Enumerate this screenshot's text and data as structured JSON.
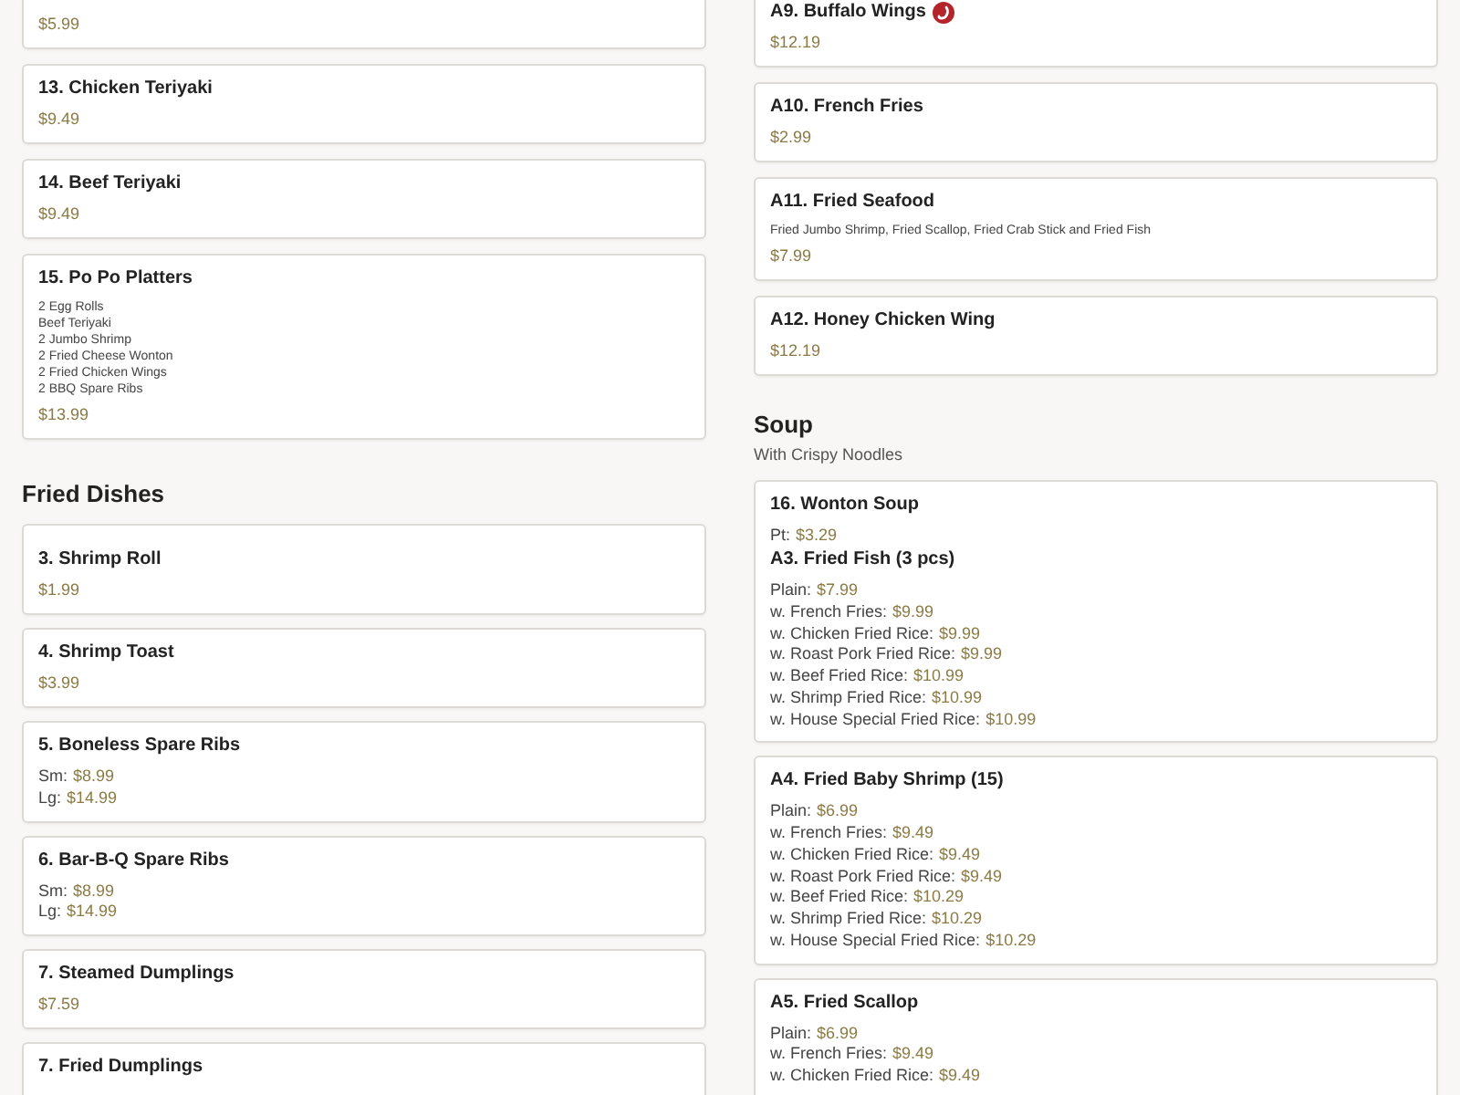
{
  "top_view": {
    "left": [
      {
        "kind": "item",
        "spicy": false,
        "prices": [
          {
            "value": "$5.99"
          }
        ]
      },
      {
        "kind": "item",
        "title": "13. Chicken Teriyaki",
        "spicy": false,
        "prices": [
          {
            "value": "$9.49"
          }
        ]
      },
      {
        "kind": "item",
        "title": "14. Beef Teriyaki",
        "spicy": false,
        "prices": [
          {
            "value": "$9.49"
          }
        ]
      },
      {
        "kind": "item",
        "title": "15. Po Po Platters",
        "spicy": false,
        "description": [
          "2 Egg Rolls",
          "Beef Teriyaki",
          "2 Jumbo Shrimp",
          "2 Fried Cheese Wonton",
          "2 Fried Chicken Wings",
          "2 BBQ Spare Ribs"
        ],
        "prices": [
          {
            "value": "$13.99"
          }
        ]
      },
      {
        "kind": "section",
        "heading": "Fried Dishes"
      },
      {
        "kind": "item",
        "spicy": false
      }
    ],
    "right": [
      {
        "kind": "item",
        "title": "A9. Buffalo Wings",
        "spicy": true,
        "prices": [
          {
            "value": "$12.19"
          }
        ]
      },
      {
        "kind": "item",
        "title": "A10. French Fries",
        "spicy": false,
        "prices": [
          {
            "value": "$2.99"
          }
        ]
      },
      {
        "kind": "item",
        "title": "A11. Fried Seafood",
        "spicy": false,
        "description": [
          "Fried Jumbo Shrimp, Fried Scallop, Fried Crab Stick and Fried Fish"
        ],
        "prices": [
          {
            "value": "$7.99"
          }
        ]
      },
      {
        "kind": "item",
        "title": "A12. Honey Chicken Wing",
        "spicy": false,
        "prices": [
          {
            "value": "$12.19"
          }
        ]
      },
      {
        "kind": "section",
        "heading": "Soup",
        "subheading": "With Crispy Noodles"
      },
      {
        "kind": "item",
        "title": "16. Wonton Soup",
        "spicy": false,
        "prices": [
          {
            "label": "Pt:",
            "value": "$3.29"
          }
        ]
      }
    ]
  },
  "bottom_view": {
    "left": [
      {
        "kind": "item",
        "title": "3. Shrimp Roll",
        "spicy": false,
        "prices": [
          {
            "value": "$1.99"
          }
        ]
      },
      {
        "kind": "item",
        "title": "4. Shrimp Toast",
        "spicy": false,
        "prices": [
          {
            "value": "$3.99"
          }
        ]
      },
      {
        "kind": "item",
        "title": "5. Boneless Spare Ribs",
        "spicy": false,
        "prices": [
          {
            "label": "Sm:",
            "value": "$8.99"
          },
          {
            "label": "Lg:",
            "value": "$14.99"
          }
        ]
      },
      {
        "kind": "item",
        "title": "6. Bar-B-Q Spare Ribs",
        "spicy": false,
        "prices": [
          {
            "label": "Sm:",
            "value": "$8.99"
          },
          {
            "label": "Lg:",
            "value": "$14.99"
          }
        ]
      },
      {
        "kind": "item",
        "title": "7. Steamed Dumplings",
        "spicy": false,
        "prices": [
          {
            "value": "$7.59"
          }
        ]
      },
      {
        "kind": "item",
        "title": "7. Fried Dumplings",
        "spicy": false
      }
    ],
    "right": [
      {
        "kind": "item",
        "title": "A3. Fried Fish (3 pcs)",
        "spicy": false,
        "prices": [
          {
            "label": "Plain:",
            "value": "$7.99"
          },
          {
            "label": "w. French Fries:",
            "value": "$9.99"
          },
          {
            "label": "w. Chicken Fried Rice:",
            "value": "$9.99"
          },
          {
            "label": "w. Roast Pork Fried Rice:",
            "value": "$9.99"
          },
          {
            "label": "w. Beef Fried Rice:",
            "value": "$10.99"
          },
          {
            "label": "w. Shrimp Fried Rice:",
            "value": "$10.99"
          },
          {
            "label": "w. House Special Fried Rice:",
            "value": "$10.99"
          }
        ]
      },
      {
        "kind": "item",
        "title": "A4. Fried Baby Shrimp (15)",
        "spicy": false,
        "prices": [
          {
            "label": "Plain:",
            "value": "$6.99"
          },
          {
            "label": "w. French Fries:",
            "value": "$9.49"
          },
          {
            "label": "w. Chicken Fried Rice:",
            "value": "$9.49"
          },
          {
            "label": "w. Roast Pork Fried Rice:",
            "value": "$9.49"
          },
          {
            "label": "w. Beef Fried Rice:",
            "value": "$10.29"
          },
          {
            "label": "w. Shrimp Fried Rice:",
            "value": "$10.29"
          },
          {
            "label": "w. House Special Fried Rice:",
            "value": "$10.29"
          }
        ]
      },
      {
        "kind": "item",
        "title": "A5. Fried Scallop",
        "spicy": false,
        "prices": [
          {
            "label": "Plain:",
            "value": "$6.99"
          },
          {
            "label": "w. French Fries:",
            "value": "$9.49"
          },
          {
            "label": "w. Chicken Fried Rice:",
            "value": "$9.49"
          }
        ]
      }
    ]
  }
}
